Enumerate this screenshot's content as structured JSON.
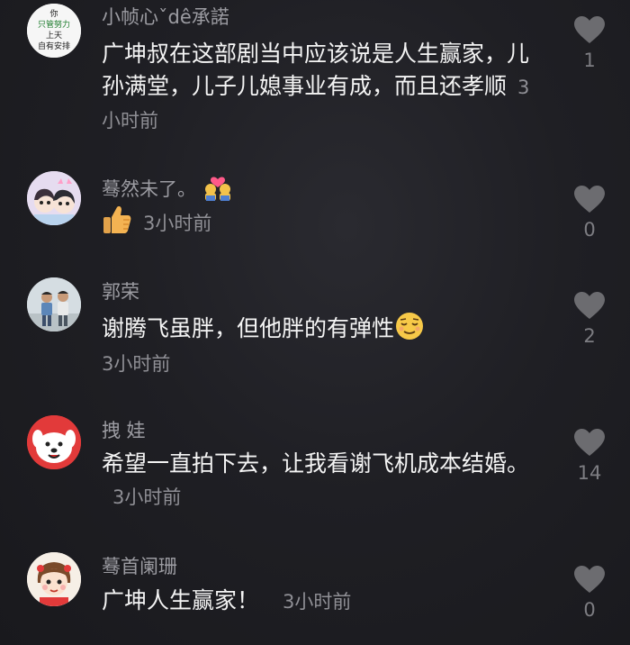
{
  "comments": [
    {
      "username": "小帧心ˇdê承諾",
      "avatar_icon": "text-badge-avatar",
      "avatar_text": [
        "你",
        "只管努力",
        "上天",
        "自有安排"
      ],
      "text": "广坤叔在这部剧当中应该说是人生赢家，儿孙满堂，儿子儿媳事业有成，而且还孝顺",
      "time": "3小时前",
      "likes": "1"
    },
    {
      "username": "蓦然未了。",
      "avatar_icon": "cartoon-couple-avatar",
      "name_emoji": "couple-emoji",
      "reply_emoji": "thumbs-up-emoji",
      "text": "",
      "time": "3小时前",
      "likes": "0"
    },
    {
      "username": "郭荣",
      "avatar_icon": "two-boys-photo-avatar",
      "text": "谢腾飞虽胖，但他胖的有弹性",
      "text_emoji": "relieved-face-emoji",
      "time": "3小时前",
      "likes": "2"
    },
    {
      "username": "拽 娃",
      "avatar_icon": "white-dog-mascot-avatar",
      "text": "希望一直拍下去，让我看谢飞机成本结婚。",
      "time": "3小时前",
      "likes": "14"
    },
    {
      "username": "蓦首阑珊",
      "avatar_icon": "cartoon-girl-avatar",
      "text": "广坤人生赢家！",
      "time": "3小时前",
      "likes": "0"
    }
  ],
  "colors": {
    "background": "#1d1d22",
    "username": "#9c9ca2",
    "body_text": "#f4f4f4",
    "meta_text": "#8f8f95",
    "heart": "#6c6c70"
  }
}
